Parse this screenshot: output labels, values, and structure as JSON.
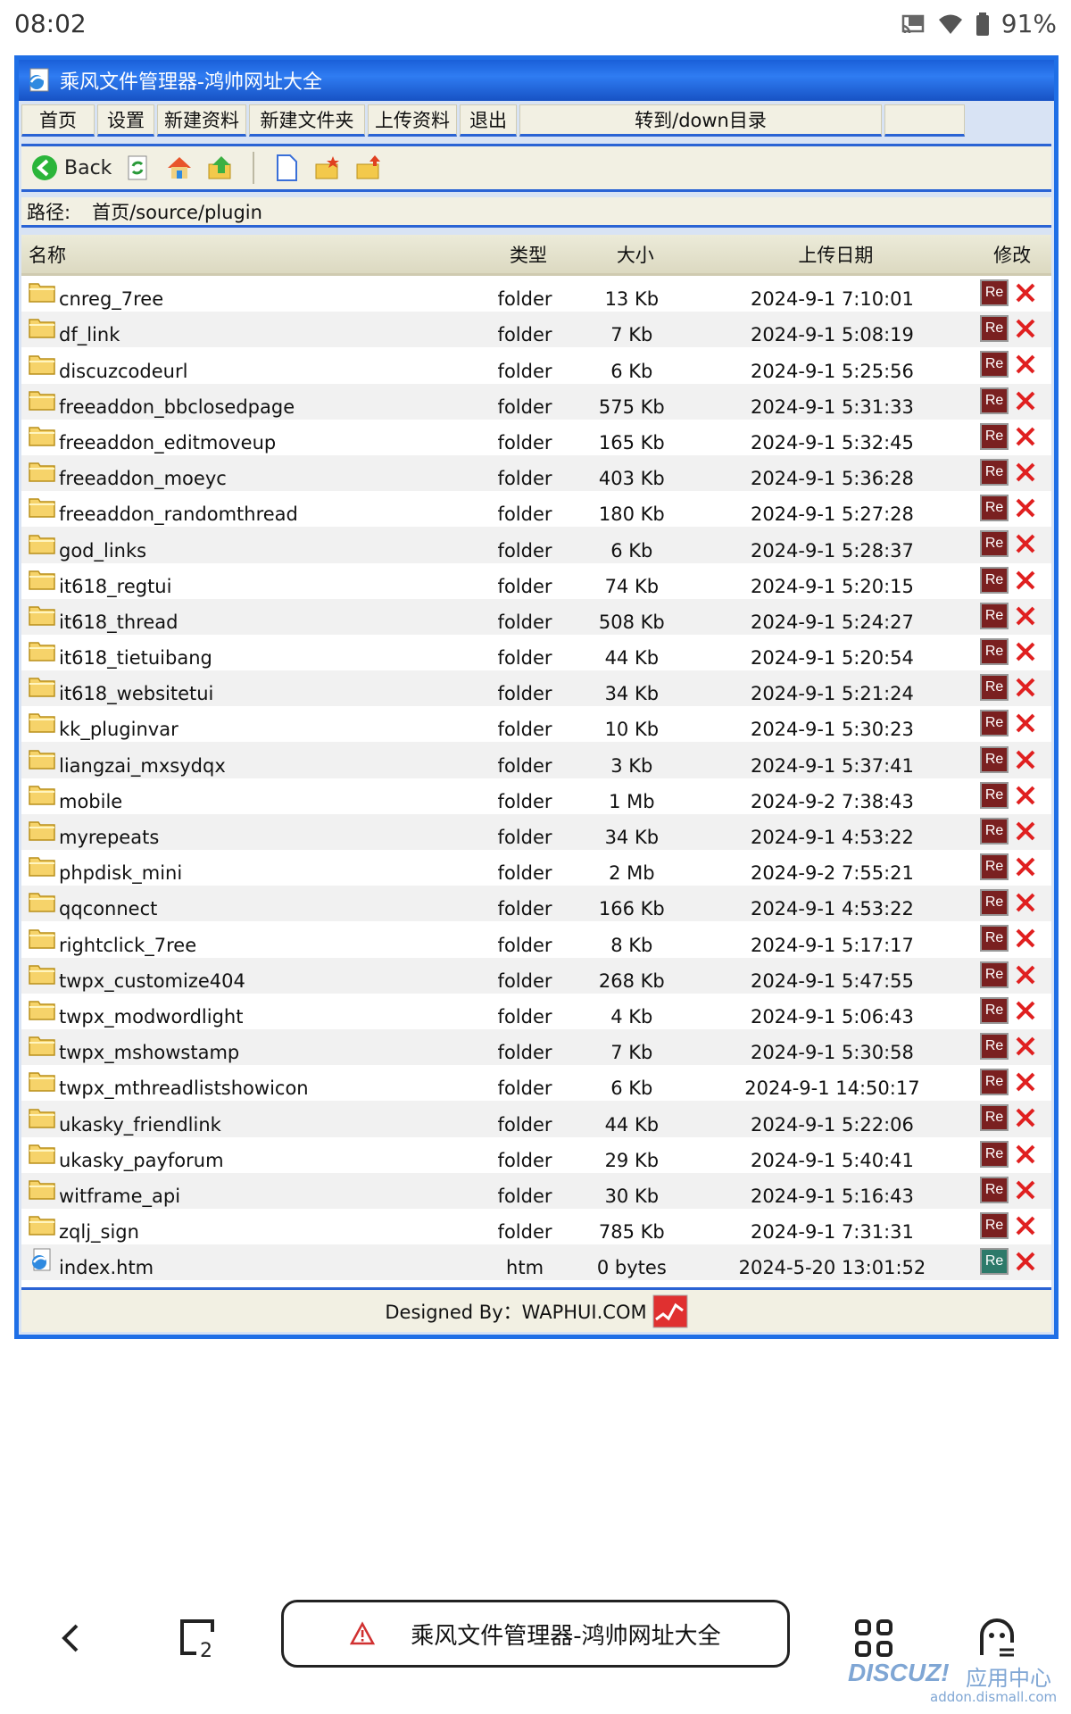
{
  "status_bar": {
    "time": "08:02",
    "battery": "91%"
  },
  "window": {
    "title": "乘风文件管理器-鸿帅网址大全"
  },
  "menu": [
    {
      "label": "首页",
      "name": "menu-home",
      "width": 82
    },
    {
      "label": "设置",
      "name": "menu-settings",
      "width": 64
    },
    {
      "label": "新建资料",
      "name": "menu-new-file",
      "width": 100
    },
    {
      "label": "新建文件夹",
      "name": "menu-new-folder",
      "width": 130
    },
    {
      "label": "上传资料",
      "name": "menu-upload",
      "width": 100
    },
    {
      "label": "退出",
      "name": "menu-exit",
      "width": 64
    },
    {
      "label": "转到/down目录",
      "name": "menu-goto-down",
      "width": 406
    },
    {
      "label": "",
      "name": "menu-empty",
      "width": 90
    }
  ],
  "toolbar": {
    "back_label": "Back"
  },
  "path": {
    "label": "路径:",
    "value": "首页/source/plugin"
  },
  "table": {
    "headers": {
      "name": "名称",
      "type": "类型",
      "size": "大小",
      "date": "上传日期",
      "edit": "修改"
    },
    "rows": [
      {
        "name": "cnreg_7ree",
        "type": "folder",
        "size": "13 Kb",
        "date": "2024-9-1 7:10:01"
      },
      {
        "name": "df_link",
        "type": "folder",
        "size": "7 Kb",
        "date": "2024-9-1 5:08:19"
      },
      {
        "name": "discuzcodeurl",
        "type": "folder",
        "size": "6 Kb",
        "date": "2024-9-1 5:25:56"
      },
      {
        "name": "freeaddon_bbclosedpage",
        "type": "folder",
        "size": "575 Kb",
        "date": "2024-9-1 5:31:33"
      },
      {
        "name": "freeaddon_editmoveup",
        "type": "folder",
        "size": "165 Kb",
        "date": "2024-9-1 5:32:45"
      },
      {
        "name": "freeaddon_moeyc",
        "type": "folder",
        "size": "403 Kb",
        "date": "2024-9-1 5:36:28"
      },
      {
        "name": "freeaddon_randomthread",
        "type": "folder",
        "size": "180 Kb",
        "date": "2024-9-1 5:27:28"
      },
      {
        "name": "god_links",
        "type": "folder",
        "size": "6 Kb",
        "date": "2024-9-1 5:28:37"
      },
      {
        "name": "it618_regtui",
        "type": "folder",
        "size": "74 Kb",
        "date": "2024-9-1 5:20:15"
      },
      {
        "name": "it618_thread",
        "type": "folder",
        "size": "508 Kb",
        "date": "2024-9-1 5:24:27"
      },
      {
        "name": "it618_tietuibang",
        "type": "folder",
        "size": "44 Kb",
        "date": "2024-9-1 5:20:54"
      },
      {
        "name": "it618_websitetui",
        "type": "folder",
        "size": "34 Kb",
        "date": "2024-9-1 5:21:24"
      },
      {
        "name": "kk_pluginvar",
        "type": "folder",
        "size": "10 Kb",
        "date": "2024-9-1 5:30:23"
      },
      {
        "name": "liangzai_mxsydqx",
        "type": "folder",
        "size": "3 Kb",
        "date": "2024-9-1 5:37:41"
      },
      {
        "name": "mobile",
        "type": "folder",
        "size": "1 Mb",
        "date": "2024-9-2 7:38:43"
      },
      {
        "name": "myrepeats",
        "type": "folder",
        "size": "34 Kb",
        "date": "2024-9-1 4:53:22"
      },
      {
        "name": "phpdisk_mini",
        "type": "folder",
        "size": "2 Mb",
        "date": "2024-9-2 7:55:21"
      },
      {
        "name": "qqconnect",
        "type": "folder",
        "size": "166 Kb",
        "date": "2024-9-1 4:53:22"
      },
      {
        "name": "rightclick_7ree",
        "type": "folder",
        "size": "8 Kb",
        "date": "2024-9-1 5:17:17"
      },
      {
        "name": "twpx_customize404",
        "type": "folder",
        "size": "268 Kb",
        "date": "2024-9-1 5:47:55"
      },
      {
        "name": "twpx_modwordlight",
        "type": "folder",
        "size": "4 Kb",
        "date": "2024-9-1 5:06:43"
      },
      {
        "name": "twpx_mshowstamp",
        "type": "folder",
        "size": "7 Kb",
        "date": "2024-9-1 5:30:58"
      },
      {
        "name": "twpx_mthreadlistshowicon",
        "type": "folder",
        "size": "6 Kb",
        "date": "2024-9-1 14:50:17"
      },
      {
        "name": "ukasky_friendlink",
        "type": "folder",
        "size": "44 Kb",
        "date": "2024-9-1 5:22:06"
      },
      {
        "name": "ukasky_payforum",
        "type": "folder",
        "size": "29 Kb",
        "date": "2024-9-1 5:40:41"
      },
      {
        "name": "witframe_api",
        "type": "folder",
        "size": "30 Kb",
        "date": "2024-9-1 5:16:43"
      },
      {
        "name": "zqlj_sign",
        "type": "folder",
        "size": "785 Kb",
        "date": "2024-9-1 7:31:31"
      },
      {
        "name": "index.htm",
        "type": "htm",
        "size": "0 bytes",
        "date": "2024-5-20 13:01:52"
      }
    ],
    "edit_label": "Re"
  },
  "footer": {
    "text": "Designed By：WAPHUI.COM"
  },
  "browser_bar": {
    "page_title": "乘风文件管理器-鸿帅网址大全"
  },
  "watermark": {
    "brand": "DISCUZ!",
    "cn": "应用中心",
    "url": "addon.dismall.com"
  },
  "colors": {
    "frame_blue": "#1f6fe6",
    "panel_bg": "#f2f0e3",
    "edit_red": "#7a2020",
    "edit_teal": "#2d7a6a",
    "delete_red": "#e02020"
  }
}
